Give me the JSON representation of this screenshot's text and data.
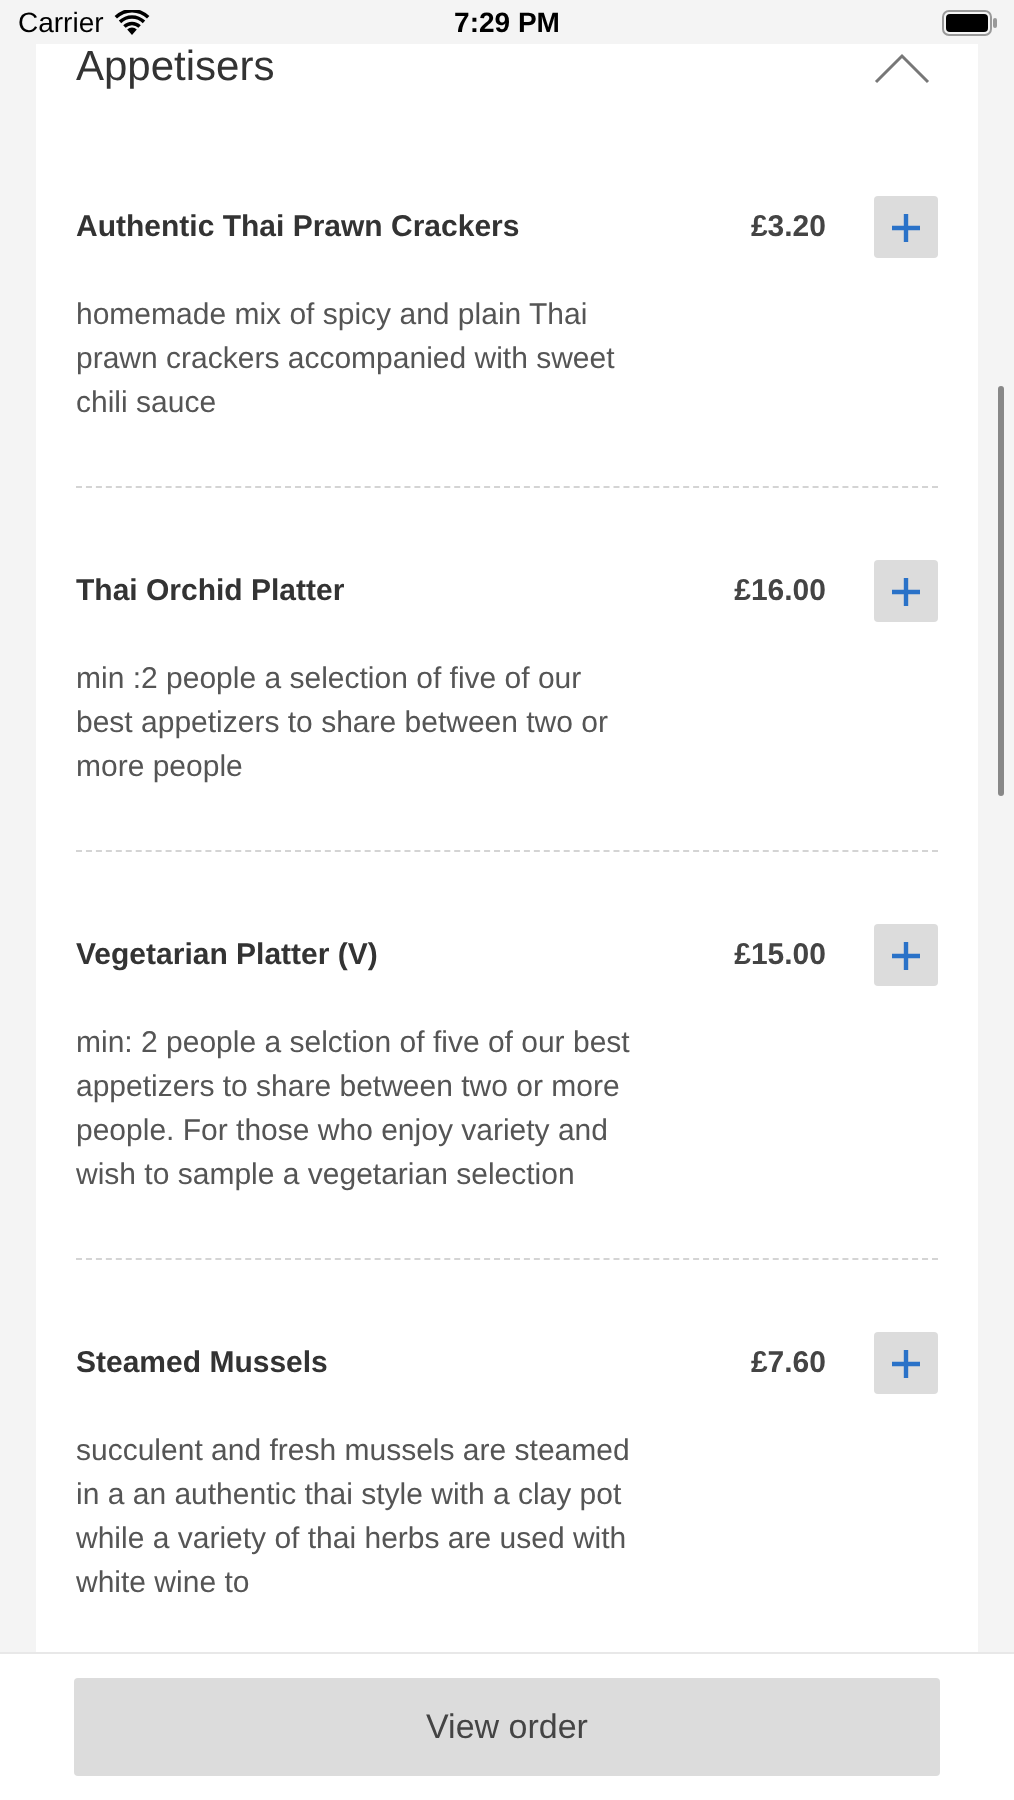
{
  "status_bar": {
    "carrier": "Carrier",
    "time": "7:29 PM"
  },
  "section": {
    "title": "Appetisers",
    "expanded": true
  },
  "items": [
    {
      "name": "Authentic Thai Prawn Crackers",
      "price": "£3.20",
      "description": "homemade mix of spicy and plain Thai prawn crackers accompanied with sweet chili sauce"
    },
    {
      "name": "Thai Orchid Platter",
      "price": "£16.00",
      "description": "min :2 people a selection of five of our best appetizers to share between two or more people"
    },
    {
      "name": "Vegetarian Platter (V)",
      "price": "£15.00",
      "description": "min: 2 people a selction of five of our best appetizers to share between two or more people. For those who enjoy variety and wish to sample a vegetarian selection"
    },
    {
      "name": "Steamed Mussels",
      "price": "£7.60",
      "description": "succulent and fresh mussels are steamed in a an authentic thai style with a clay pot while a variety of thai herbs are used with white wine to"
    }
  ],
  "footer": {
    "button": "View order"
  }
}
